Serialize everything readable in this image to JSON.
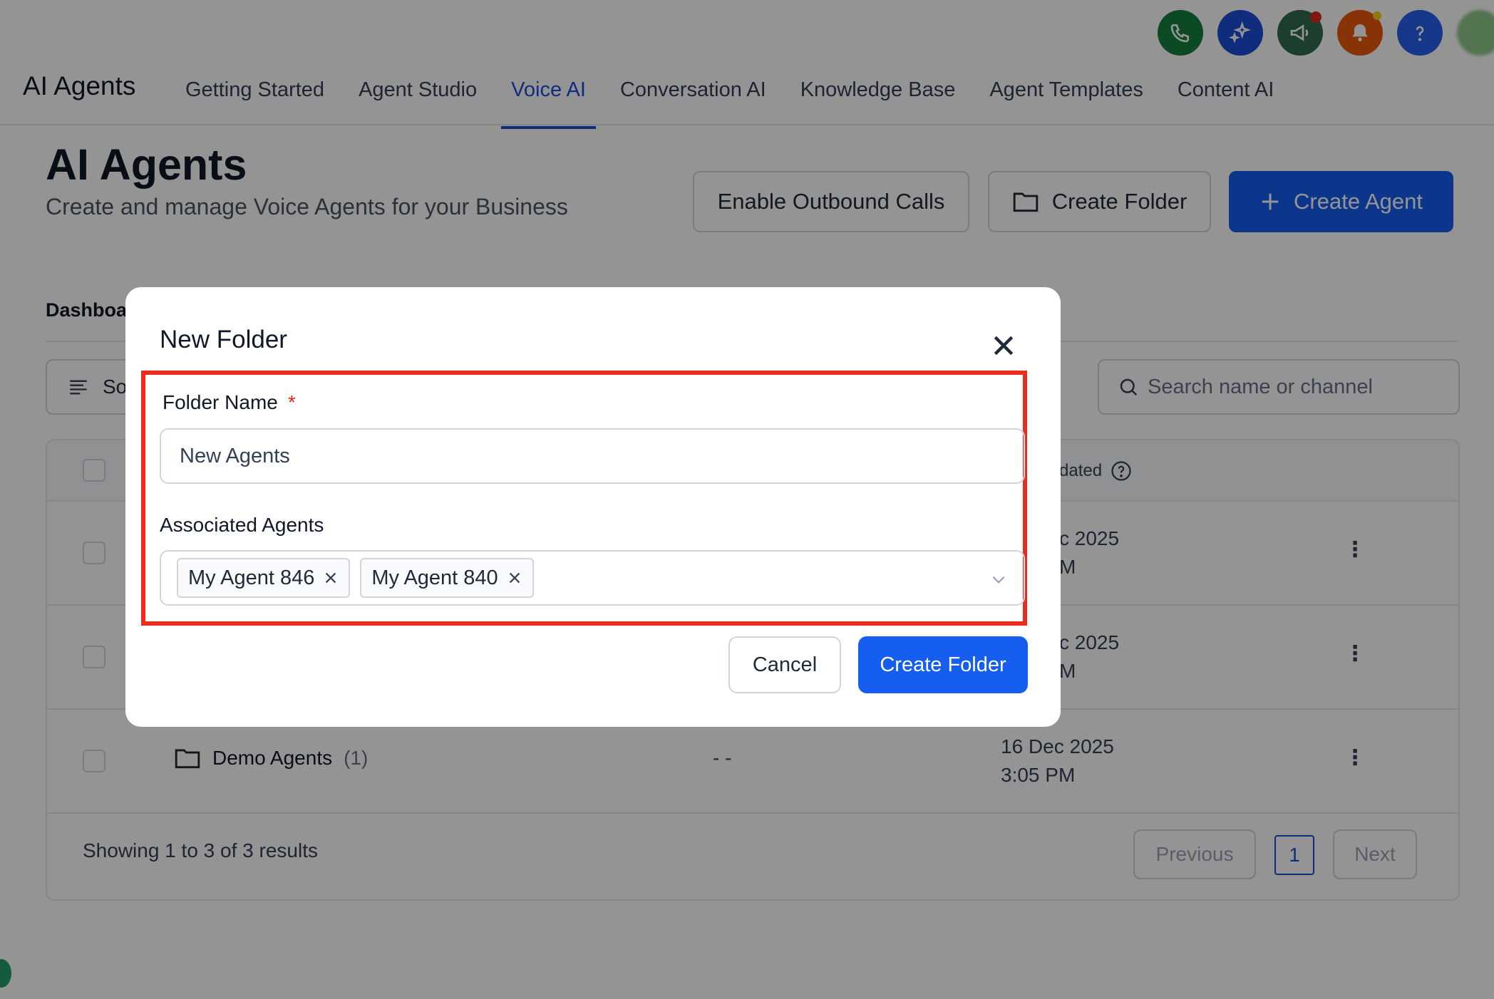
{
  "header": {
    "brand": "AI Agents",
    "nav": [
      "Getting Started",
      "Agent Studio",
      "Voice AI",
      "Conversation AI",
      "Knowledge Base",
      "Agent Templates",
      "Content AI"
    ],
    "active_nav": "Voice AI",
    "icon_colors": {
      "phone": "#15803d",
      "sparkle": "#1d4ed8",
      "megaphone": "#2f6b4f",
      "bell": "#ea580c",
      "help": "#2563eb"
    }
  },
  "page": {
    "title": "AI Agents",
    "subtitle": "Create and manage Voice Agents for your Business",
    "enable_outbound": "Enable Outbound Calls",
    "create_folder": "Create Folder",
    "create_agent": "Create Agent",
    "tab_label": "Dashboa",
    "sort_label": "So",
    "search_placeholder": "Search name or channel"
  },
  "table": {
    "updated_header": "dated",
    "rows": [
      {
        "date": "c 2025",
        "time": "M"
      },
      {
        "date": "c 2025",
        "time": "M"
      },
      {
        "name": "Demo Agents",
        "count": "(1)",
        "channel": "- -",
        "date": "16 Dec 2025",
        "time": "3:05 PM"
      }
    ],
    "summary": "Showing 1 to 3 of 3 results",
    "previous": "Previous",
    "page": "1",
    "next": "Next"
  },
  "modal": {
    "title": "New Folder",
    "folder_name_label": "Folder Name",
    "required_mark": "*",
    "folder_name_value": "New Agents",
    "associated_label": "Associated Agents",
    "chips": [
      "My Agent 846",
      "My Agent 840"
    ],
    "cancel": "Cancel",
    "submit": "Create Folder"
  }
}
